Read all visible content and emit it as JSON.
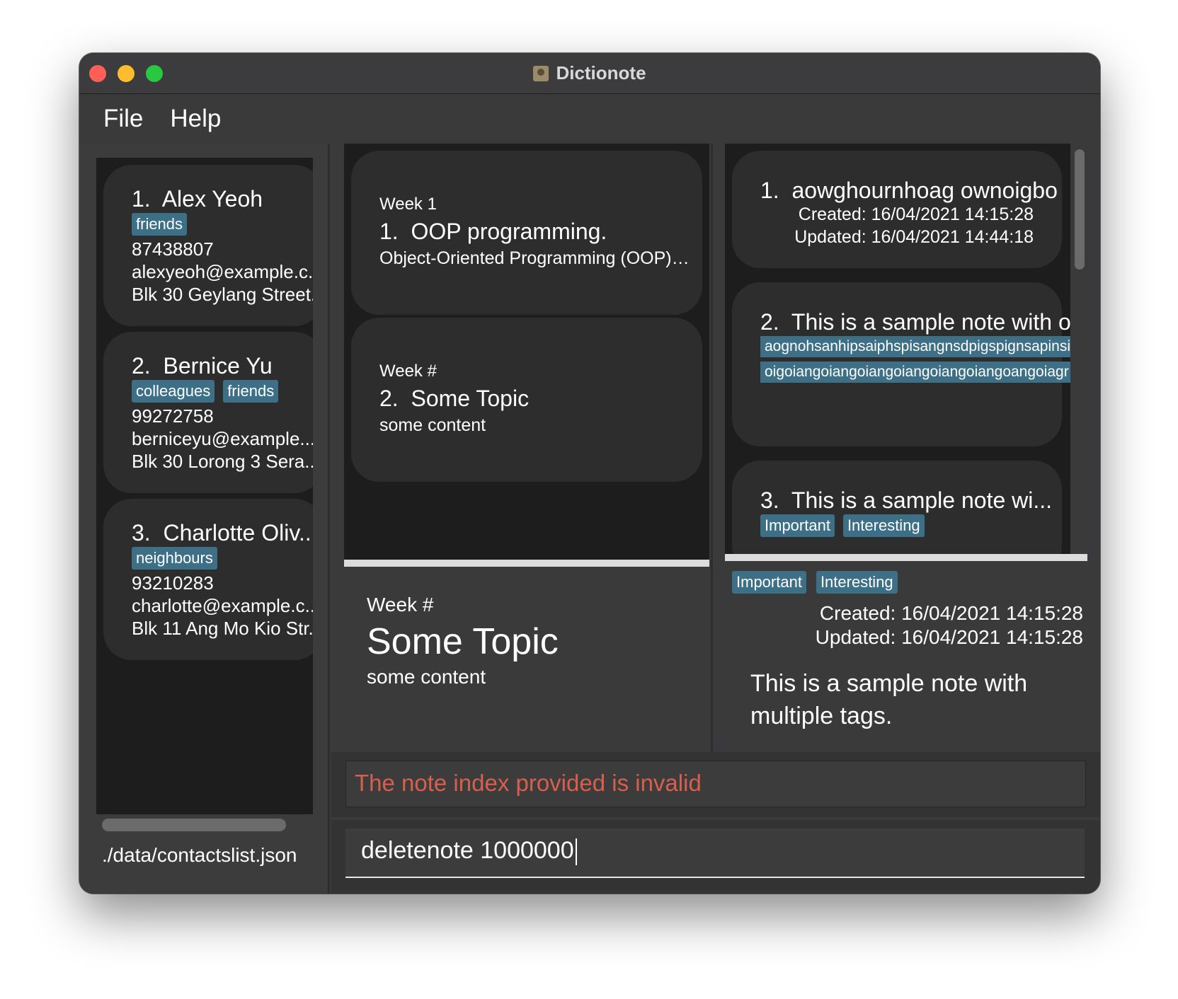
{
  "window": {
    "title": "Dictionote"
  },
  "menu": {
    "items": [
      "File",
      "Help"
    ]
  },
  "contacts": [
    {
      "index": "1.",
      "name": "Alex Yeoh",
      "tags": [
        "friends"
      ],
      "phone": "87438807",
      "email": "alexyeoh@example.c...",
      "address": "Blk 30 Geylang Street..."
    },
    {
      "index": "2.",
      "name": "Bernice Yu",
      "tags": [
        "colleagues",
        "friends"
      ],
      "phone": "99272758",
      "email": "berniceyu@example....",
      "address": "Blk 30 Lorong 3 Sera..."
    },
    {
      "index": "3.",
      "name": "Charlotte Oliv...",
      "tags": [
        "neighbours"
      ],
      "phone": "93210283",
      "email": "charlotte@example.c...",
      "address": "Blk 11 Ang Mo Kio Str..."
    }
  ],
  "status_bar": {
    "path": "./data/contactslist.json"
  },
  "topics": [
    {
      "week": "Week 1",
      "index": "1.",
      "title": "OOP programming.",
      "content": "Object-Oriented Programming (OOP) ..."
    },
    {
      "week": "Week #",
      "index": "2.",
      "title": "Some Topic",
      "content": "some content"
    }
  ],
  "topic_detail": {
    "week": "Week #",
    "title": "Some Topic",
    "content": "some content"
  },
  "notes": [
    {
      "index": "1.",
      "title": "aowghournhoag ownoigbo",
      "created": "Created: 16/04/2021 14:15:28",
      "updated": "Updated: 16/04/2021 14:44:18"
    },
    {
      "index": "2.",
      "title": "This is a sample note with one",
      "tags": [
        "aognohsanhipsaiphspisangnsdpigspignsapinsi",
        "oigoiangoiangoiangoiangoiangoiangoangoiagr"
      ]
    },
    {
      "index": "3.",
      "title": "This is a sample note wi...",
      "tags": [
        "Important",
        "Interesting"
      ]
    }
  ],
  "note_detail": {
    "tags": [
      "Important",
      "Interesting"
    ],
    "created": "Created: 16/04/2021 14:15:28",
    "updated": "Updated: 16/04/2021 14:15:28",
    "body": "This is a sample note with multiple tags."
  },
  "result": {
    "message": "The note index provided is invalid",
    "color": "#d6604d"
  },
  "command": {
    "value": "deletenote 1000000"
  },
  "colors": {
    "tag_bg": "#3d6f87",
    "card_bg": "#2d2d2d",
    "list_bg": "#1d1d1d",
    "window_bg": "#3a3a3c"
  }
}
